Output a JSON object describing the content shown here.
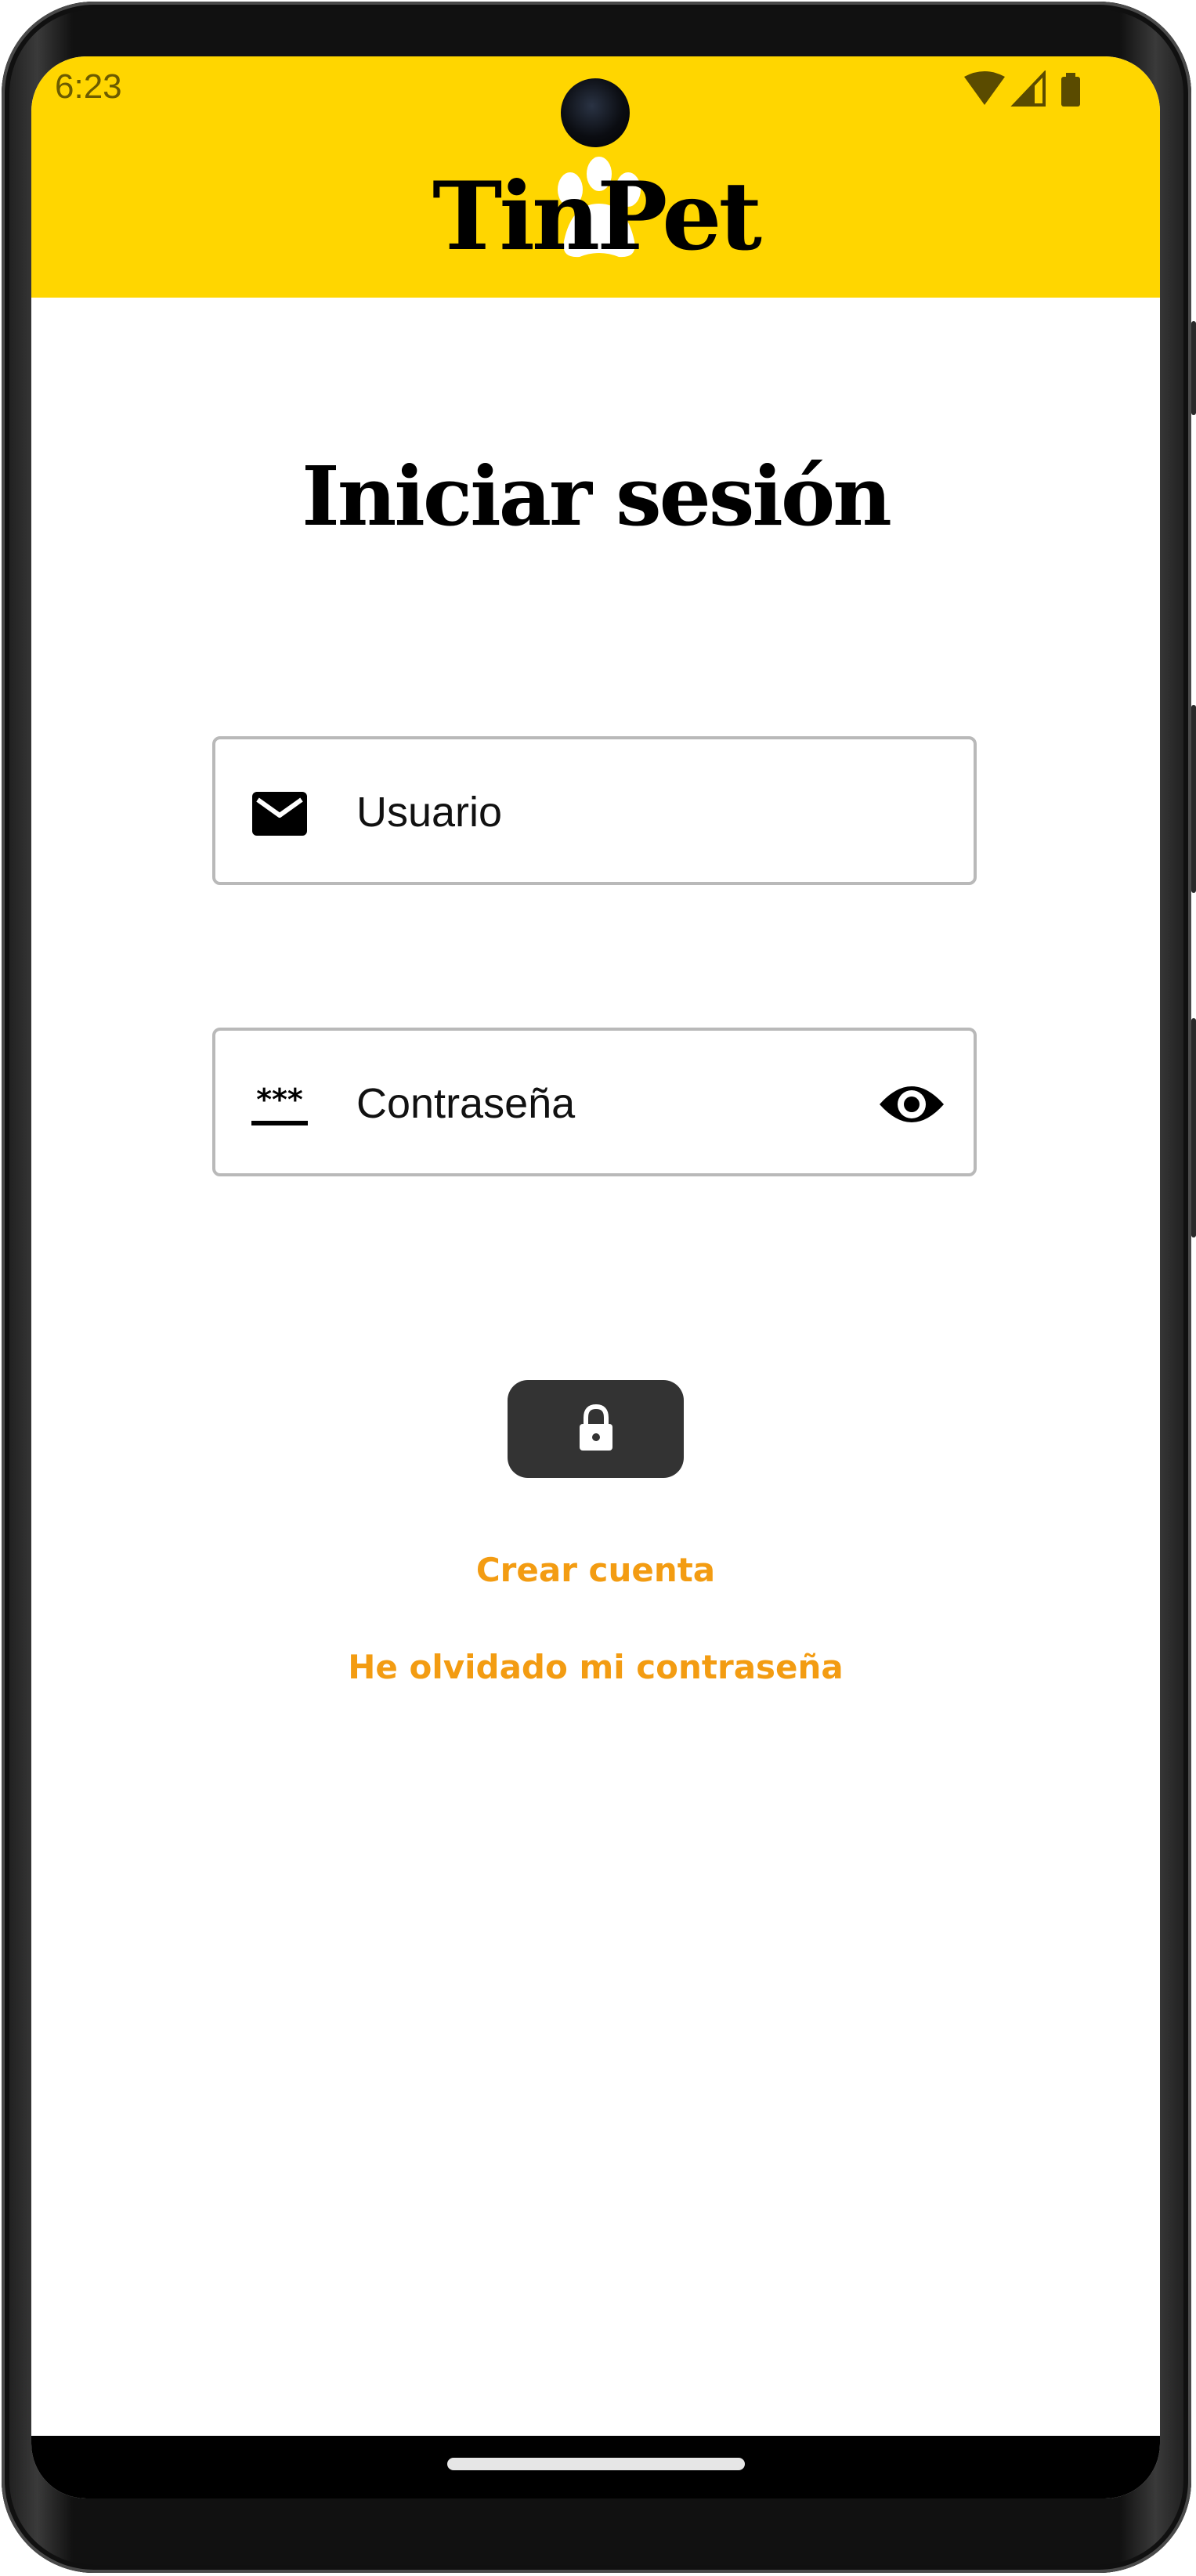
{
  "status_bar": {
    "time": "6:23",
    "icons": [
      "wifi-icon",
      "signal-icon",
      "battery-icon"
    ]
  },
  "app_bar": {
    "logo_text": "TinPet",
    "background": "#ffd600"
  },
  "page": {
    "title": "Iniciar sesión"
  },
  "form": {
    "username": {
      "value": "Usuario",
      "icon": "email-icon"
    },
    "password": {
      "value": "Contraseña",
      "icon": "password-icon",
      "toggle_icon": "eye-icon"
    },
    "login_button": {
      "icon": "lock-icon",
      "background": "#333333"
    }
  },
  "links": {
    "create_account": "Crear cuenta",
    "forgot_password": "He olvidado mi contraseña",
    "color": "#f39c12"
  }
}
